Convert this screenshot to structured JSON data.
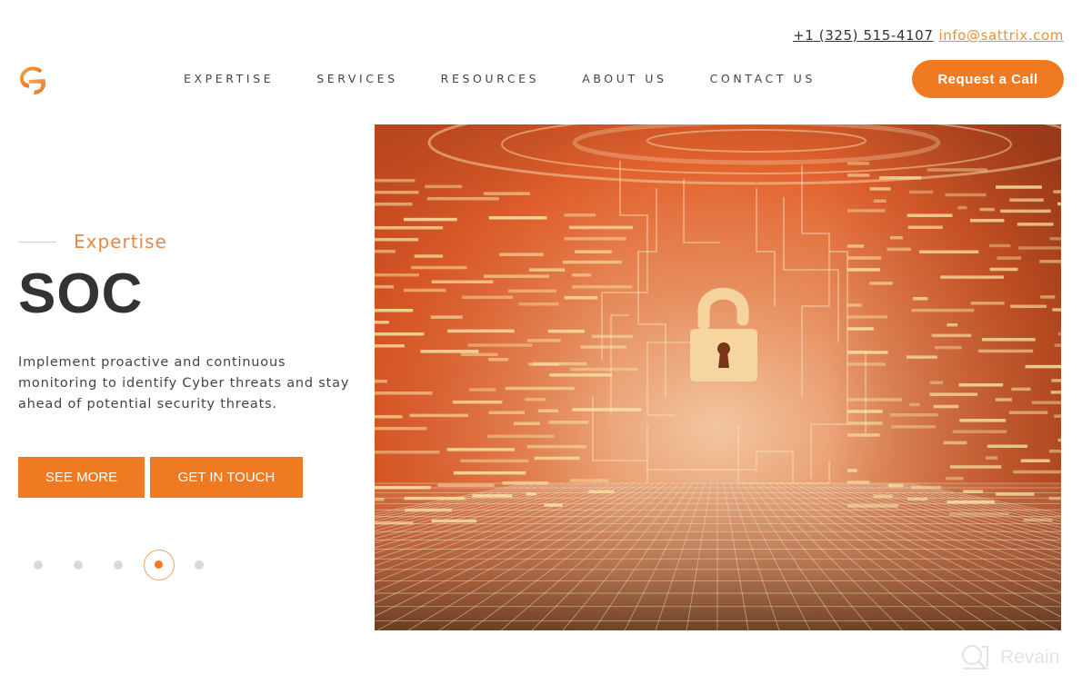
{
  "topbar": {
    "phone": "+1 (325) 515-4107",
    "email": "info@sattrix.com"
  },
  "header": {
    "logo_icon": "sattrix-s-logo-icon",
    "nav": [
      {
        "label": "EXPERTISE"
      },
      {
        "label": "SERVICES"
      },
      {
        "label": "RESOURCES"
      },
      {
        "label": "ABOUT US"
      },
      {
        "label": "CONTACT US"
      }
    ],
    "cta_label": "Request a Call"
  },
  "hero": {
    "kicker": "Expertise",
    "title": "SOC",
    "description": "Implement proactive and continuous monitoring to identify Cyber threats and stay ahead of potential security threats.",
    "buttons": {
      "see_more": "SEE MORE",
      "get_in_touch": "GET IN TOUCH"
    },
    "image_icon": "unlocked-padlock-icon",
    "slides_total": 5,
    "active_slide": 4
  },
  "colors": {
    "accent": "#f07a22",
    "kicker": "#e28a45",
    "heading": "#333333"
  },
  "watermark": {
    "text": "Revain"
  }
}
